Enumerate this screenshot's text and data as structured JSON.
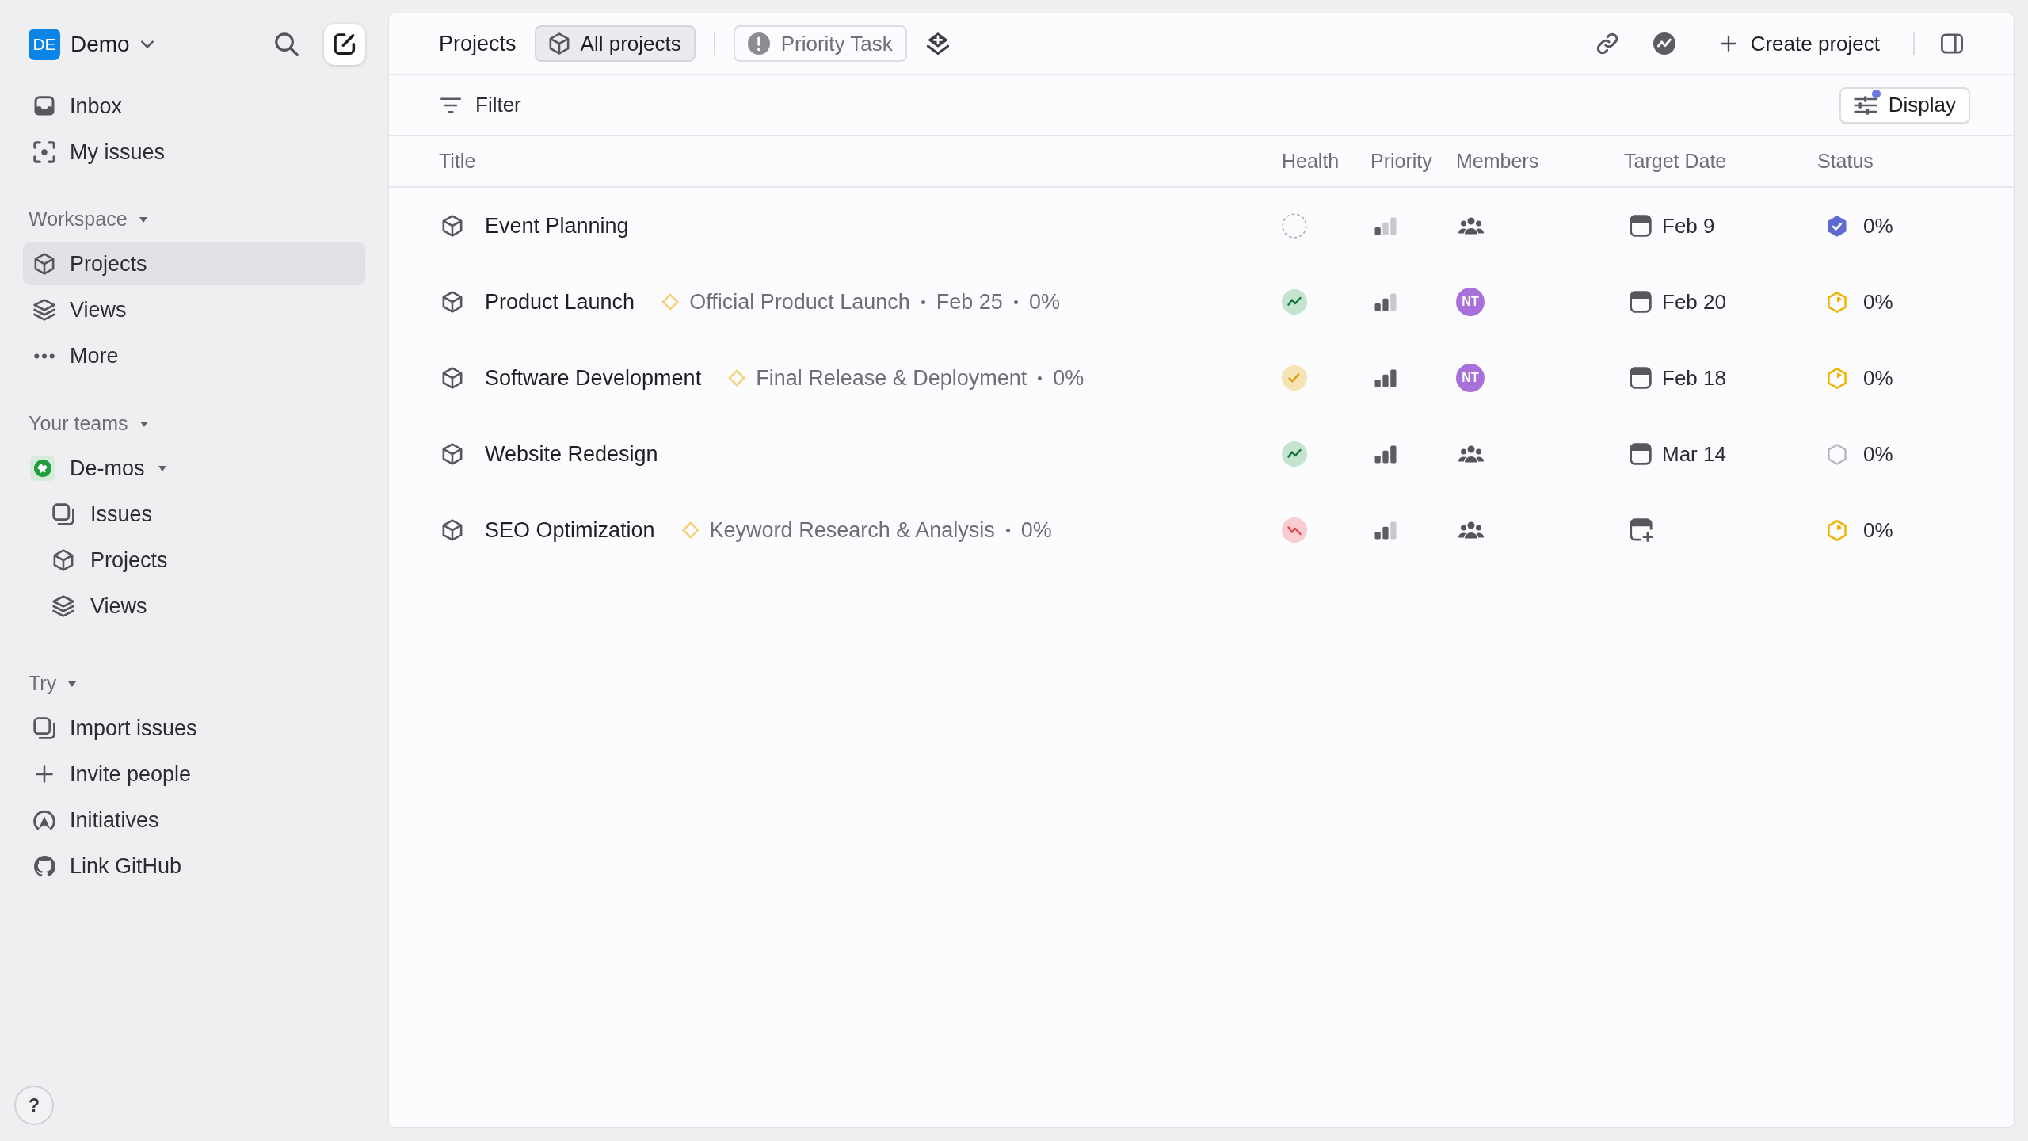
{
  "sidebar": {
    "workspace": {
      "initials": "DE",
      "name": "Demo"
    },
    "top_items": [
      {
        "label": "Inbox",
        "selected": false
      },
      {
        "label": "My issues",
        "selected": false
      }
    ],
    "workspace_section": {
      "title": "Workspace",
      "expanded": true,
      "items": [
        {
          "label": "Projects",
          "selected": true
        },
        {
          "label": "Views",
          "selected": false
        },
        {
          "label": "More",
          "selected": false
        }
      ]
    },
    "teams_section": {
      "title": "Your teams",
      "expanded": true,
      "teams": [
        {
          "name": "De-mos",
          "expanded": true,
          "children": [
            {
              "label": "Issues",
              "selected": false
            },
            {
              "label": "Projects",
              "selected": false
            },
            {
              "label": "Views",
              "selected": false
            }
          ]
        }
      ]
    },
    "try_section": {
      "title": "Try",
      "expanded": true,
      "items": [
        {
          "label": "Import issues"
        },
        {
          "label": "Invite people"
        },
        {
          "label": "Initiatives"
        },
        {
          "label": "Link GitHub"
        }
      ]
    },
    "help": "?"
  },
  "top_bar": {
    "title": "Projects",
    "views": [
      {
        "label": "All projects",
        "selected": true
      },
      {
        "label": "Priority Task",
        "selected": false
      }
    ],
    "create_button": "Create project"
  },
  "filter_bar": {
    "filter": "Filter",
    "display": "Display",
    "display_changed": true
  },
  "table": {
    "columns": [
      "Title",
      "Health",
      "Priority",
      "Members",
      "Target Date",
      "Status"
    ],
    "rows": [
      {
        "title": "Event Planning",
        "health": {
          "kind": "none"
        },
        "priority": {
          "kind": "low"
        },
        "target_date": "Feb 9",
        "status": {
          "kind": "completed"
        },
        "progress": "0%"
      },
      {
        "title": "Product Launch",
        "milestone": {
          "name": "Official Product Launch",
          "date": "Feb 25",
          "progress": "0%",
          "level": 0
        },
        "health": {
          "kind": "on_track"
        },
        "priority": {
          "kind": "medium"
        },
        "member": "NT",
        "target_date": "Feb 20",
        "status": {
          "kind": "in_progress"
        },
        "progress": "0%"
      },
      {
        "title": "Software Development",
        "milestone": {
          "name": "Final Release & Deployment",
          "progress": "0%",
          "level": 0
        },
        "health": {
          "kind": "at_risk"
        },
        "priority": {
          "kind": "high"
        },
        "member": "NT",
        "target_date": "Feb 18",
        "status": {
          "kind": "in_progress"
        },
        "progress": "0%"
      },
      {
        "title": "Website Redesign",
        "health": {
          "kind": "on_track"
        },
        "priority": {
          "kind": "high"
        },
        "target_date": "Mar 14",
        "status": {
          "kind": "planned"
        },
        "progress": "0%"
      },
      {
        "title": "SEO Optimization",
        "milestone": {
          "name": "Keyword Research & Analysis",
          "progress": "0%",
          "level": 0
        },
        "health": {
          "kind": "off_track"
        },
        "priority": {
          "kind": "medium"
        },
        "status": {
          "kind": "in_progress"
        },
        "progress": "0%"
      }
    ]
  }
}
